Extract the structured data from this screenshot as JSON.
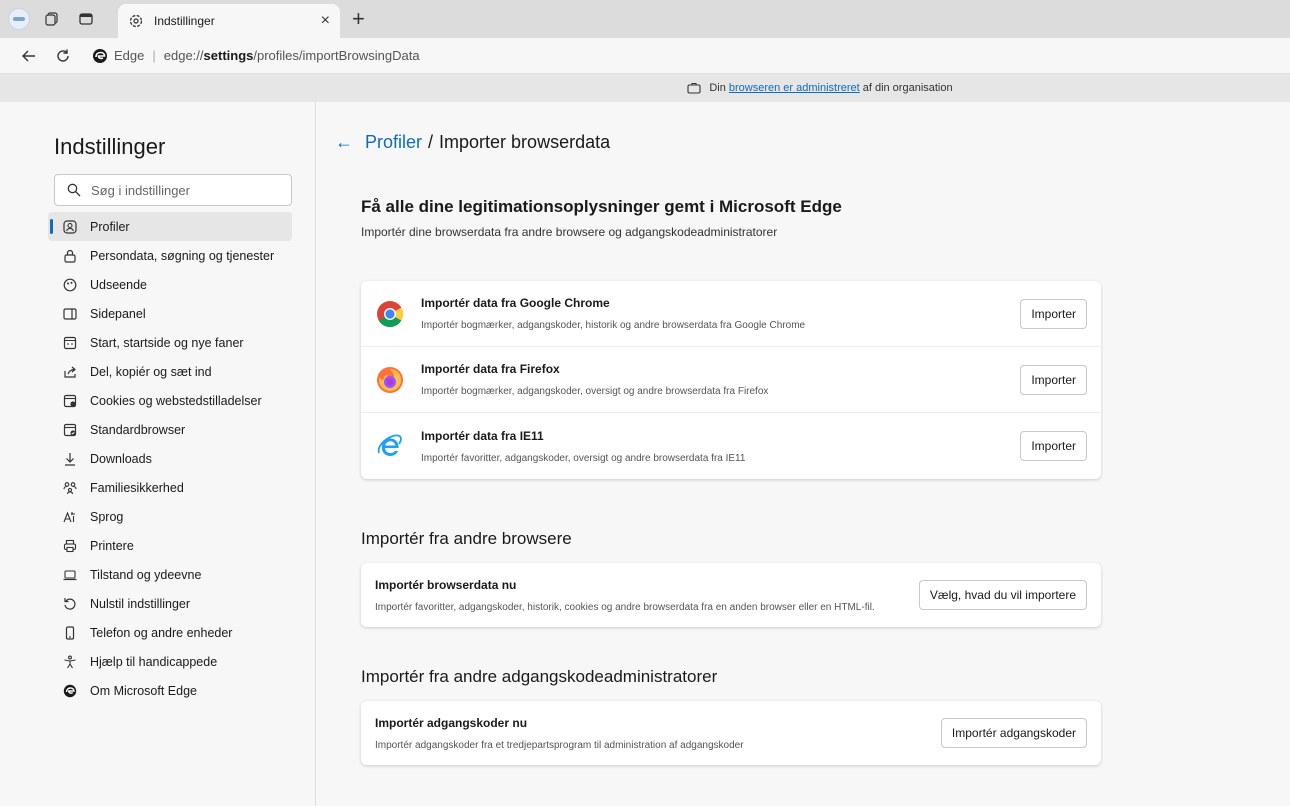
{
  "tab": {
    "title": "Indstillinger",
    "close": "×",
    "new_tab": "+"
  },
  "address": {
    "site": "Edge",
    "url_prefix": "edge://",
    "url_bold": "settings",
    "url_rest": "/profiles/importBrowsingData"
  },
  "managed": {
    "prefix": "Din",
    "link": "browseren er administreret",
    "suffix": "af din organisation"
  },
  "sidebar": {
    "title": "Indstillinger",
    "search_placeholder": "Søg i indstillinger",
    "items": [
      {
        "label": "Profiler",
        "icon": "profile-icon"
      },
      {
        "label": "Persondata, søgning og tjenester",
        "icon": "lock-icon"
      },
      {
        "label": "Udseende",
        "icon": "appearance-icon"
      },
      {
        "label": "Sidepanel",
        "icon": "sidepanel-icon"
      },
      {
        "label": "Start, startside og nye faner",
        "icon": "start-icon"
      },
      {
        "label": "Del, kopiér og sæt ind",
        "icon": "share-icon"
      },
      {
        "label": "Cookies og webstedstilladelser",
        "icon": "cookies-icon"
      },
      {
        "label": "Standardbrowser",
        "icon": "default-browser-icon"
      },
      {
        "label": "Downloads",
        "icon": "download-icon"
      },
      {
        "label": "Familiesikkerhed",
        "icon": "family-icon"
      },
      {
        "label": "Sprog",
        "icon": "language-icon"
      },
      {
        "label": "Printere",
        "icon": "printer-icon"
      },
      {
        "label": "Tilstand og ydeevne",
        "icon": "laptop-icon"
      },
      {
        "label": "Nulstil indstillinger",
        "icon": "reset-icon"
      },
      {
        "label": "Telefon og andre enheder",
        "icon": "phone-icon"
      },
      {
        "label": "Hjælp til handicappede",
        "icon": "accessibility-icon"
      },
      {
        "label": "Om Microsoft Edge",
        "icon": "edge-icon"
      }
    ]
  },
  "breadcrumb": {
    "back": "←",
    "parent": "Profiler",
    "sep": "/",
    "current": "Importer browserdata"
  },
  "hero": {
    "title": "Få alle dine legitimationsoplysninger gemt i Microsoft Edge",
    "subtitle": "Importér dine browserdata fra andre browsere og adgangskodeadministratorer"
  },
  "browsers": [
    {
      "title": "Importér data fra Google Chrome",
      "desc": "Importér bogmærker, adgangskoder, historik og andre browserdata fra Google Chrome",
      "button": "Importer"
    },
    {
      "title": "Importér data fra Firefox",
      "desc": "Importér bogmærker, adgangskoder, oversigt og andre browserdata fra Firefox",
      "button": "Importer"
    },
    {
      "title": "Importér data fra IE11",
      "desc": "Importér favoritter, adgangskoder, oversigt og andre browserdata fra IE11",
      "button": "Importer"
    }
  ],
  "other_browsers": {
    "heading": "Importér fra andre browsere",
    "title": "Importér browserdata nu",
    "desc": "Importér favoritter, adgangskoder, historik, cookies og andre browserdata fra en anden browser eller en HTML-fil.",
    "button": "Vælg, hvad du vil importere"
  },
  "password_managers": {
    "heading": "Importér fra andre adgangskodeadministratorer",
    "title": "Importér adgangskoder nu",
    "desc": "Importér adgangskoder fra et tredjepartsprogram til administration af adgangskoder",
    "button": "Importér adgangskoder"
  },
  "colors": {
    "accent": "#0f6cbd",
    "background": "#f7f7f7"
  }
}
